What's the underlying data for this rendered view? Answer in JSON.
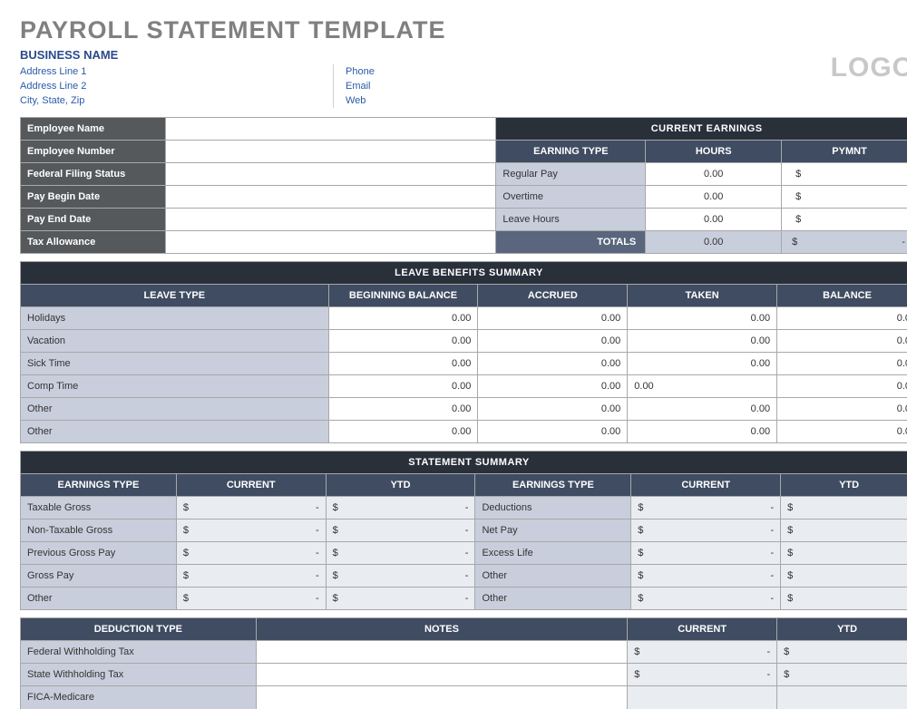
{
  "title": "PAYROLL STATEMENT TEMPLATE",
  "business": {
    "name": "BUSINESS NAME",
    "addr1": "Address Line 1",
    "addr2": "Address Line 2",
    "csz": "City, State, Zip",
    "phone": "Phone",
    "email": "Email",
    "web": "Web",
    "logo": "LOGO"
  },
  "emp": {
    "l0": "Employee Name",
    "l1": "Employee Number",
    "l2": "Federal Filing Status",
    "l3": "Pay Begin Date",
    "l4": "Pay End Date",
    "l5": "Tax Allowance"
  },
  "earnings": {
    "title": "CURRENT EARNINGS",
    "h0": "EARNING TYPE",
    "h1": "HOURS",
    "h2": "PYMNT",
    "r0": "Regular Pay",
    "r1": "Overtime",
    "r2": "Leave Hours",
    "totals": "TOTALS",
    "zero": "0.00",
    "dol": "$",
    "dash": "-"
  },
  "leave": {
    "title": "LEAVE BENEFITS SUMMARY",
    "h0": "LEAVE TYPE",
    "h1": "BEGINNING BALANCE",
    "h2": "ACCRUED",
    "h3": "TAKEN",
    "h4": "BALANCE",
    "rows": [
      "Holidays",
      "Vacation",
      "Sick Time",
      "Comp Time",
      "Other",
      "Other"
    ],
    "zero": "0.00",
    "zeroR": "0.0"
  },
  "stmt": {
    "title": "STATEMENT SUMMARY",
    "h0": "EARNINGS TYPE",
    "h1": "CURRENT",
    "h2": "YTD",
    "left": [
      "Taxable Gross",
      "Non-Taxable Gross",
      "Previous Gross Pay",
      "Gross Pay",
      "Other"
    ],
    "right": [
      "Deductions",
      "Net Pay",
      "Excess Life",
      "Other",
      "Other"
    ],
    "dol": "$",
    "dash": "-"
  },
  "ded": {
    "h0": "DEDUCTION TYPE",
    "h1": "NOTES",
    "h2": "CURRENT",
    "h3": "YTD",
    "rows": [
      "Federal Withholding Tax",
      "State Withholding Tax",
      "FICA-Medicare"
    ],
    "dol": "$",
    "dash": "-"
  }
}
